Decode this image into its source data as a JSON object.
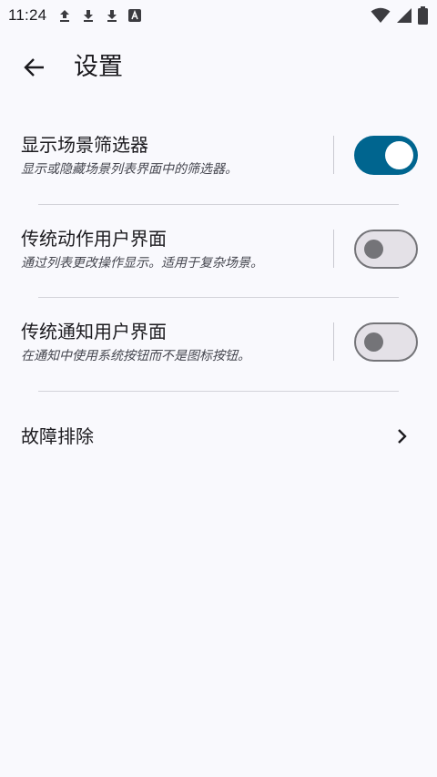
{
  "status_bar": {
    "time": "11:24",
    "notification_icons": [
      "upload-icon",
      "download-icon",
      "download-icon",
      "translate-icon"
    ],
    "system_icons": [
      "wifi-icon",
      "signal-icon",
      "battery-icon"
    ]
  },
  "app_bar": {
    "back_icon": "arrow-back-icon",
    "title": "设置"
  },
  "settings": [
    {
      "title": "显示场景筛选器",
      "description": "显示或隐藏场景列表界面中的筛选器。",
      "enabled": true
    },
    {
      "title": "传统动作用户界面",
      "description": "通过列表更改操作显示。适用于复杂场景。",
      "enabled": false
    },
    {
      "title": "传统通知用户界面",
      "description": "在通知中使用系统按钮而不是图标按钮。",
      "enabled": false
    }
  ],
  "troubleshooting": {
    "label": "故障排除",
    "icon": "chevron-right-icon"
  },
  "colors": {
    "background": "#f9f9fd",
    "switch_on_track": "#00658f",
    "switch_off_track": "#e4e1e7",
    "switch_off_outline": "#747478"
  }
}
